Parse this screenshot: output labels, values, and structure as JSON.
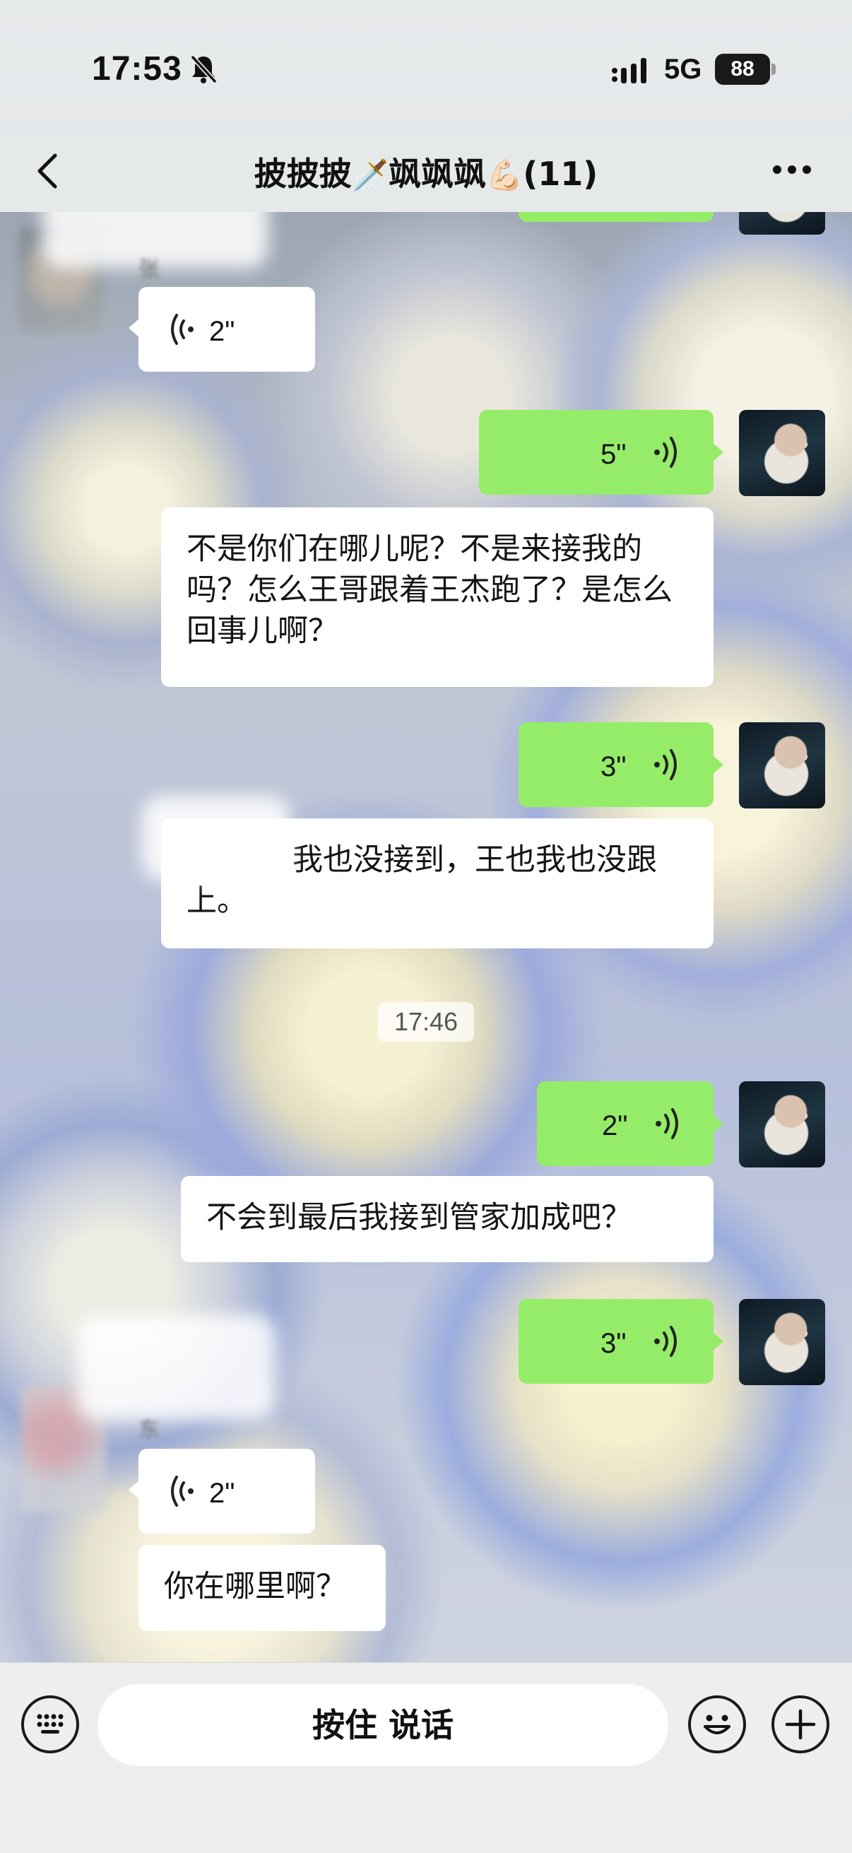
{
  "status_bar": {
    "time": "17:53",
    "network": "5G",
    "battery": "88",
    "icons": [
      "bell-muted-icon",
      "signal-icon",
      "battery-icon"
    ]
  },
  "nav": {
    "title_part1": "披披披",
    "title_emoji1": "🗡️",
    "title_part2": "飒飒飒",
    "title_emoji2": "💪🏻",
    "title_count": "(11)",
    "icons": [
      "back-icon",
      "more-icon"
    ]
  },
  "messages": [
    {
      "side": "left",
      "type": "voice",
      "duration": "2\""
    },
    {
      "side": "right",
      "type": "voice",
      "duration": "5\""
    },
    {
      "side": "right",
      "type": "text",
      "text": "不是你们在哪儿呢？不是来接我的吗？怎么王哥跟着王杰跑了？是怎么回事儿啊？"
    },
    {
      "side": "right",
      "type": "voice",
      "duration": "3\""
    },
    {
      "side": "right",
      "type": "text",
      "text": "我也没接到，王也我也没跟上。"
    },
    {
      "side": "center",
      "type": "time",
      "text": "17:46"
    },
    {
      "side": "right",
      "type": "voice",
      "duration": "2\""
    },
    {
      "side": "right",
      "type": "text",
      "text": "不会到最后我接到管家加成吧？"
    },
    {
      "side": "right",
      "type": "voice",
      "duration": "3\""
    },
    {
      "side": "left",
      "type": "voice",
      "duration": "2\""
    },
    {
      "side": "left",
      "type": "text",
      "text": "你在哪里啊？"
    }
  ],
  "input_bar": {
    "hold_to_talk": "按住 说话",
    "icons": [
      "keyboard-icon",
      "emoji-icon",
      "add-icon"
    ]
  },
  "colors": {
    "my_bubble": "#95ec69",
    "other_bubble": "#ffffff",
    "bar_bg": "#e6e9ea"
  }
}
